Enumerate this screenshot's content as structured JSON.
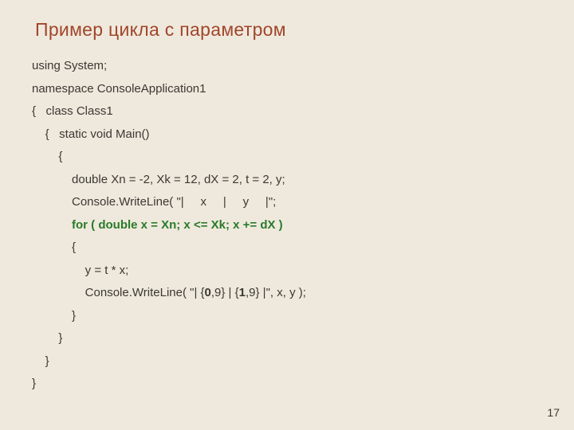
{
  "title": "Пример цикла с параметром",
  "page_number": "17",
  "code": {
    "l1": "using System;",
    "l2": "namespace ConsoleApplication1",
    "l3": "{   class Class1",
    "l4": "    {   static void Main()",
    "l5": "        {",
    "l6": "            double Xn = -2, Xk = 12, dX = 2, t = 2, y;",
    "l7": "            Console.WriteLine( \"|     x     |     y     |\";",
    "l8p": "            ",
    "l8": "for ( double x = Xn; x <= Xk; x += dX )",
    "l9": "            {",
    "l10": "                y = t * x;",
    "l11a": "                Console.WriteLine( \"| {",
    "l11b": "0",
    "l11c": ",9} | {",
    "l11d": "1",
    "l11e": ",9} |\", x, y );",
    "l12": "            }",
    "l13": "        }",
    "l14": "    }",
    "l15": "}"
  }
}
